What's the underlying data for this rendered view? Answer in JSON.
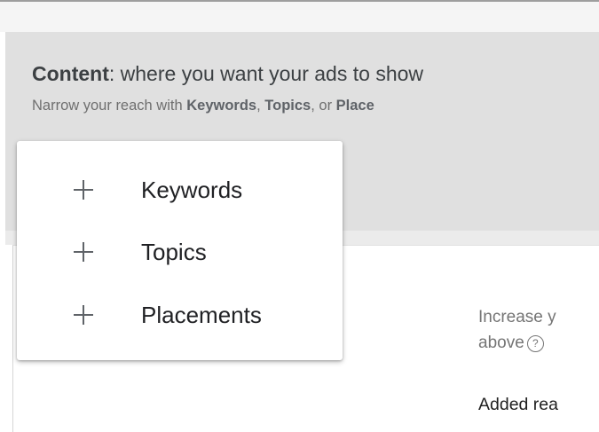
{
  "content_section": {
    "heading_bold": "Content",
    "heading_rest": ": where you want your ads to show",
    "subtitle_prefix": "Narrow your reach with ",
    "subtitle_keywords": "Keywords",
    "subtitle_sep1": ", ",
    "subtitle_topics": "Topics",
    "subtitle_sep2": ", or ",
    "subtitle_placements": "Place"
  },
  "add_menu": {
    "items": [
      {
        "label": "Keywords",
        "icon": "plus-icon"
      },
      {
        "label": "Topics",
        "icon": "plus-icon"
      },
      {
        "label": "Placements",
        "icon": "plus-icon"
      }
    ]
  },
  "reach_panel": {
    "increase_line1": "Increase y",
    "increase_line2": "above",
    "help_glyph": "?",
    "added_label": "Added rea"
  }
}
